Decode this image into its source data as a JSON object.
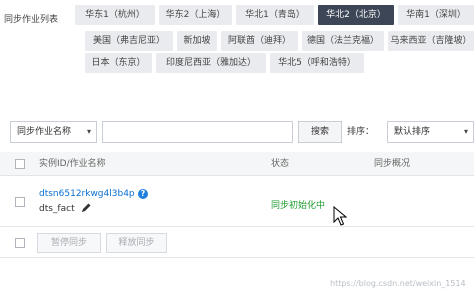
{
  "region_bar": {
    "label": "同步作业列表",
    "tabs": [
      {
        "label": "华东1（杭州）",
        "active": false
      },
      {
        "label": "华东2（上海）",
        "active": false
      },
      {
        "label": "华北1（青岛）",
        "active": false
      },
      {
        "label": "华北2（北京）",
        "active": true
      },
      {
        "label": "华南1（深圳）",
        "active": false
      },
      {
        "label": "美国（弗吉尼亚）",
        "active": false
      },
      {
        "label": "新加坡",
        "active": false
      },
      {
        "label": "阿联酋（迪拜）",
        "active": false
      },
      {
        "label": "德国（法兰克福）",
        "active": false
      },
      {
        "label": "马来西亚（吉隆坡）",
        "active": false
      },
      {
        "label": "日本（东京）",
        "active": false
      },
      {
        "label": "印度尼西亚（雅加达）",
        "active": false
      },
      {
        "label": "华北5（呼和浩特）",
        "active": false
      }
    ]
  },
  "filter": {
    "field_select": "同步作业名称",
    "search_value": "",
    "search_button": "搜索",
    "sort_label": "排序：",
    "sort_select": "默认排序"
  },
  "table": {
    "headers": {
      "id_name": "实例ID/作业名称",
      "status": "状态",
      "overview": "同步概况"
    },
    "rows": [
      {
        "job_id": "dtsn6512rkwg4l3b4p",
        "job_name": "dts_fact",
        "status": "同步初始化中"
      }
    ]
  },
  "footer": {
    "pause_button": "暂停同步",
    "release_button": "释放同步"
  },
  "watermark": "https://blog.csdn.net/weixin_1514",
  "colors": {
    "active_tab_bg": "#3c4657",
    "tab_bg": "#e9ebee",
    "link": "#0a6fd2",
    "status_ok": "#1e9a2f"
  }
}
